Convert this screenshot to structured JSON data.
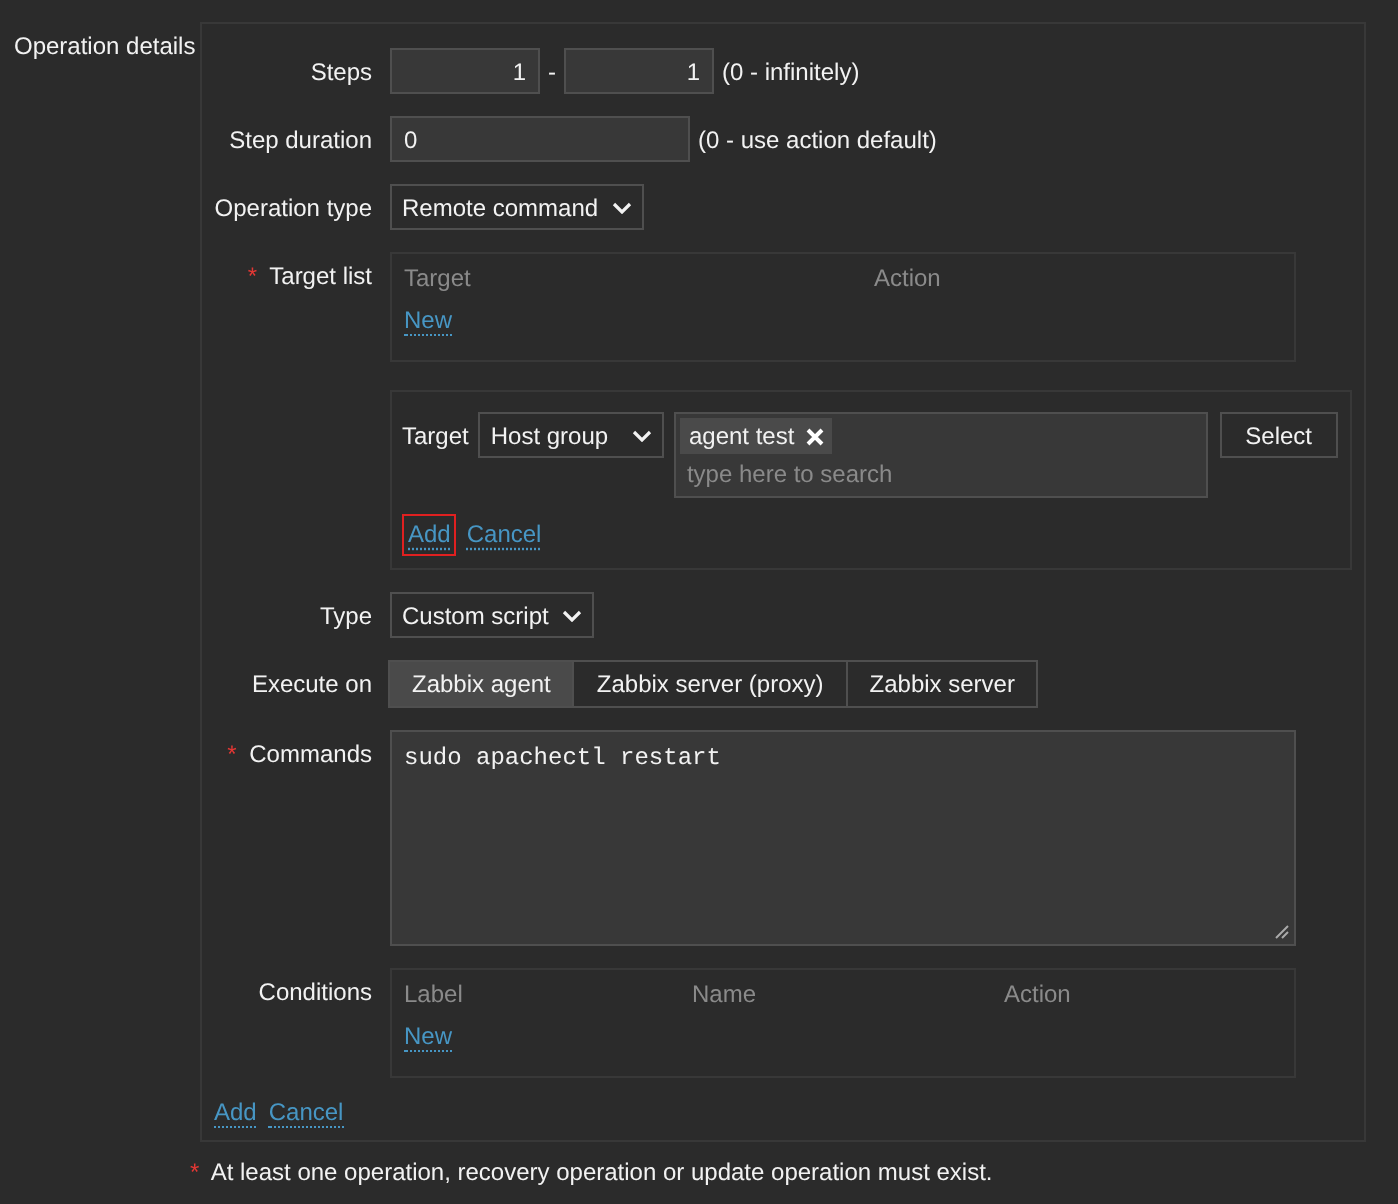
{
  "section_label": "Operation details",
  "steps": {
    "label": "Steps",
    "from": "1",
    "separator": "-",
    "to": "1",
    "hint": "(0 - infinitely)"
  },
  "step_duration": {
    "label": "Step duration",
    "value": "0",
    "hint": "(0 - use action default)"
  },
  "operation_type": {
    "label": "Operation type",
    "value": "Remote command"
  },
  "target_list": {
    "label": "Target list",
    "required_mark": "*",
    "columns": [
      "Target",
      "Action"
    ],
    "new_link": "New"
  },
  "target_editor": {
    "label": "Target",
    "type_value": "Host group",
    "tags": [
      {
        "label": "agent test"
      }
    ],
    "placeholder": "type here to search",
    "select_button": "Select",
    "links": [
      {
        "label": "Add",
        "highlighted": true
      },
      {
        "label": "Cancel",
        "highlighted": false
      }
    ]
  },
  "type": {
    "label": "Type",
    "value": "Custom script"
  },
  "execute_on": {
    "label": "Execute on",
    "options": [
      {
        "label": "Zabbix agent",
        "selected": true
      },
      {
        "label": "Zabbix server (proxy)",
        "selected": false
      },
      {
        "label": "Zabbix server",
        "selected": false
      }
    ]
  },
  "commands": {
    "label": "Commands",
    "required_mark": "*",
    "value": "sudo apachectl restart"
  },
  "conditions": {
    "label": "Conditions",
    "columns": [
      "Label",
      "Name",
      "Action"
    ],
    "new_link": "New"
  },
  "actions": [
    {
      "label": "Add"
    },
    {
      "label": "Cancel"
    }
  ],
  "footer_note": {
    "mark": "*",
    "text": "At least one operation, recovery operation or update operation must exist."
  }
}
